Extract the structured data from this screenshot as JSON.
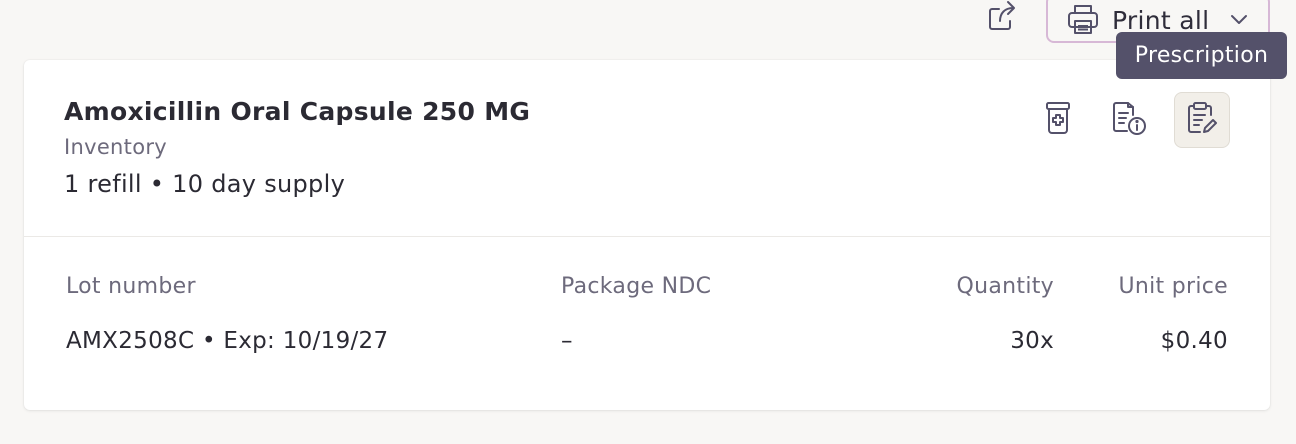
{
  "toolbar": {
    "share_icon": "share-icon",
    "print_icon": "printer-icon",
    "print_label": "Print all",
    "chevron_icon": "chevron-down-icon"
  },
  "tooltip": {
    "text": "Prescription"
  },
  "medication": {
    "name": "Amoxicillin Oral Capsule 250 MG",
    "source": "Inventory",
    "supply": "1 refill • 10 day supply",
    "actions": [
      {
        "icon": "pharmacy-bottle-icon"
      },
      {
        "icon": "document-info-icon"
      },
      {
        "icon": "clipboard-edit-icon",
        "active": true
      }
    ]
  },
  "table": {
    "headers": {
      "lot": "Lot number",
      "ndc": "Package NDC",
      "quantity": "Quantity",
      "price": "Unit price"
    },
    "rows": [
      {
        "lot": "AMX2508C • Exp: 10/19/27",
        "ndc": "–",
        "quantity": "30x",
        "price": "$0.40"
      }
    ]
  },
  "colors": {
    "background": "#f8f7f5",
    "text": "#2b2a33",
    "muted": "#6d6a7c",
    "print_border": "#d7b8d6",
    "tooltip_bg": "#54516a",
    "active_action_bg": "#f2efe9"
  }
}
